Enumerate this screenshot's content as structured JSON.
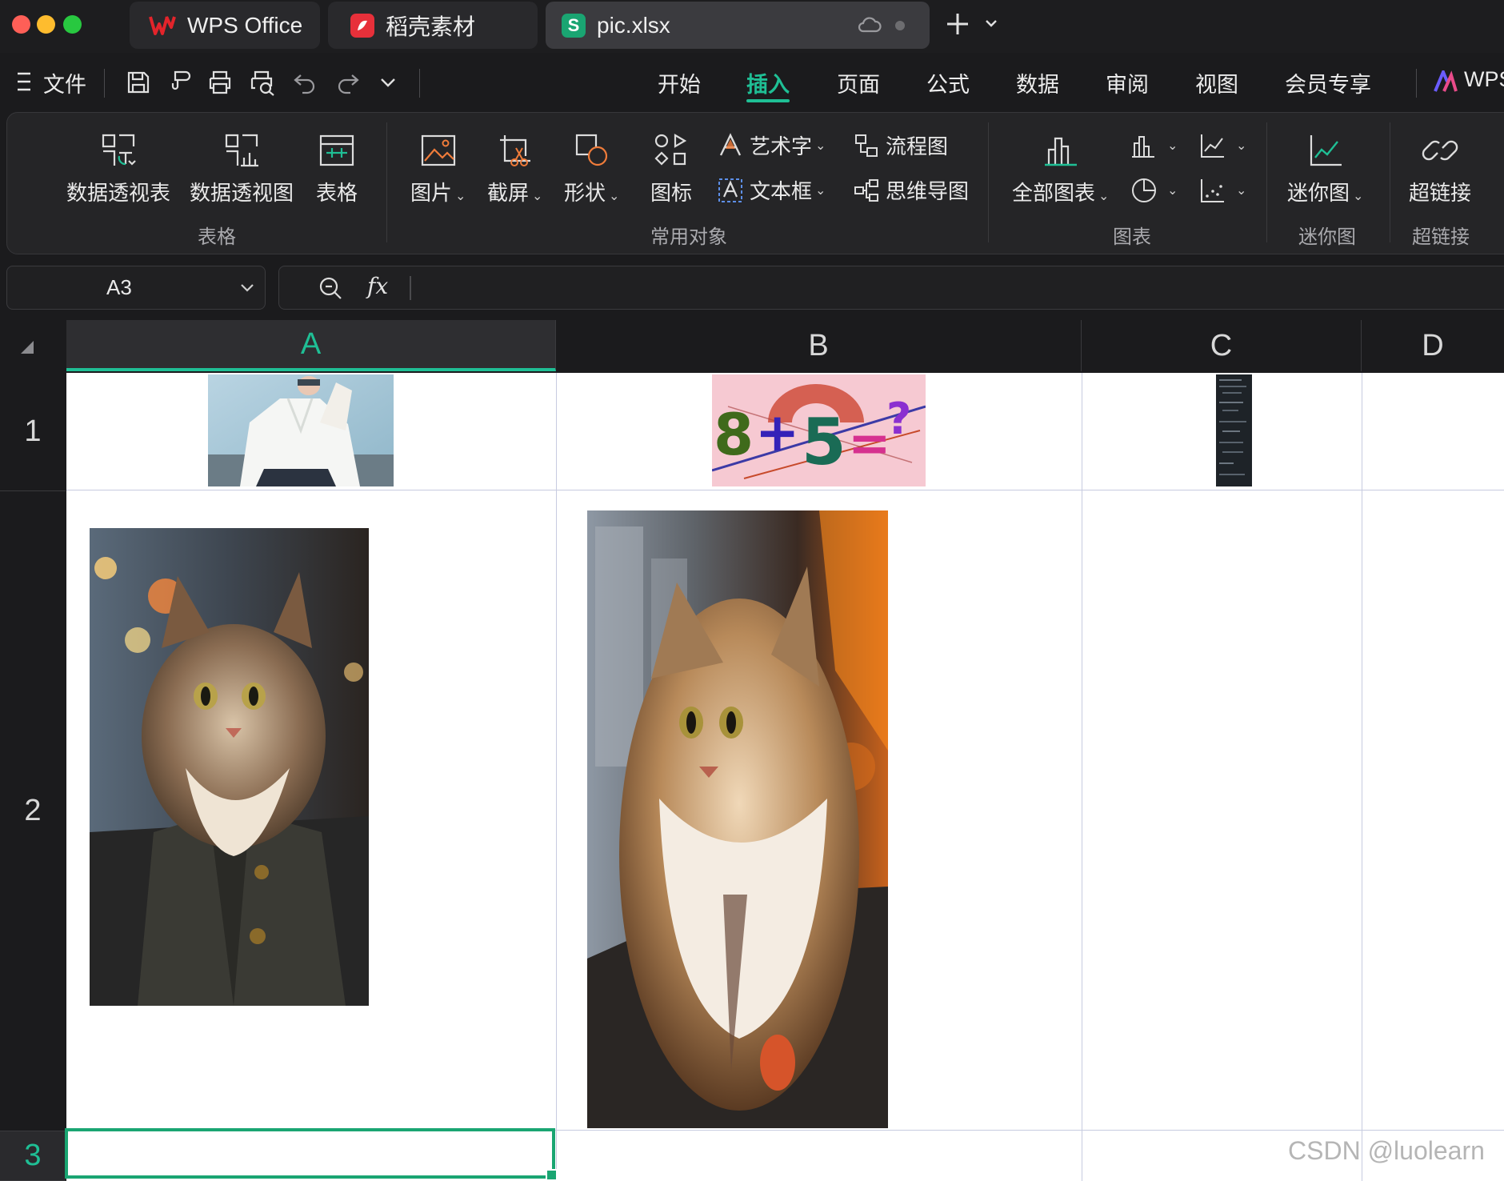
{
  "window": {
    "tabs": [
      {
        "label": "WPS Office",
        "icon": "wps-logo-icon"
      },
      {
        "label": "稻壳素材",
        "icon": "docer-logo-icon"
      },
      {
        "label": "pic.xlsx",
        "icon": "spreadsheet-s-icon",
        "active": true
      }
    ]
  },
  "menubar": {
    "file_label": "文件",
    "tabs": [
      "开始",
      "插入",
      "页面",
      "公式",
      "数据",
      "审阅",
      "视图",
      "会员专享"
    ],
    "active_tab": "插入",
    "wps_ai_label": "WPS"
  },
  "ribbon": {
    "table_group": {
      "label": "表格",
      "buttons": [
        "数据透视表",
        "数据透视图",
        "表格"
      ]
    },
    "objects_group": {
      "label": "常用对象",
      "buttons": [
        "图片",
        "截屏",
        "形状",
        "图标"
      ],
      "small": [
        "艺术字",
        "文本框",
        "流程图",
        "思维导图"
      ]
    },
    "chart_group": {
      "label": "图表",
      "all_charts": "全部图表"
    },
    "sparkline_group": {
      "label": "迷你图",
      "button": "迷你图"
    },
    "hyperlink_group": {
      "label": "超链接",
      "button": "超链接"
    }
  },
  "formula_bar": {
    "name_box": "A3",
    "fx_label": "fx",
    "formula": ""
  },
  "grid": {
    "columns": [
      "A",
      "B",
      "C",
      "D"
    ],
    "rows": [
      "1",
      "2",
      "3"
    ],
    "active_column": "A",
    "active_row": "3",
    "selected_cell": "A3"
  },
  "watermark": "CSDN @luolearn",
  "colors": {
    "accent": "#1fbf95",
    "wps_red": "#e3242b",
    "grid_line": "#c7cbe0"
  }
}
